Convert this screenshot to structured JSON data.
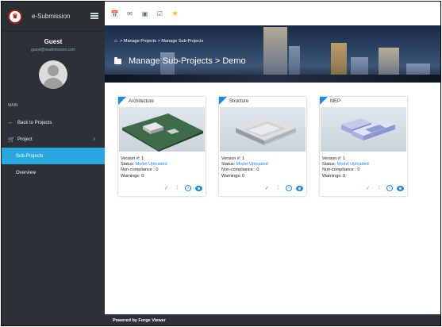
{
  "brand": {
    "name": "e-Submission",
    "logo_icon": "crest-logo"
  },
  "user": {
    "name": "Guest",
    "email": "guest@esubmission.com"
  },
  "sidebar": {
    "section_label": "MAIN",
    "items": [
      {
        "label": "Back to Projects",
        "icon": "arrow-left-icon"
      },
      {
        "label": "Project",
        "icon": "cart-icon"
      },
      {
        "label": "Sub-Projects",
        "active": true
      },
      {
        "label": "Overview"
      }
    ],
    "active_color": "#29a8e0"
  },
  "topbar": {
    "icons": [
      "calendar-icon",
      "mail-icon",
      "chat-icon",
      "checkbox-icon",
      "star-icon"
    ]
  },
  "breadcrumb": {
    "text": "> Manage Projects > Manage Sub-Projects"
  },
  "page_title": "Manage Sub-Projects > Demo",
  "cards": [
    {
      "title": "Architecture",
      "version_label": "Version #:",
      "version": "1",
      "status_label": "Status:",
      "status": "Model Uploaded",
      "noncompliance": "Non-compliance : 0",
      "warnings": "Warnings: 0"
    },
    {
      "title": "Structure",
      "version_label": "Version #:",
      "version": "1",
      "status_label": "Status:",
      "status": "Model Uploaded",
      "noncompliance": "Non-compliance : 0",
      "warnings": "Warnings: 0"
    },
    {
      "title": "MEP",
      "version_label": "Version #:",
      "version": "1",
      "status_label": "Status:",
      "status": "Model Uploaded",
      "noncompliance": "Non-compliance : 0",
      "warnings": "Warnings: 0"
    }
  ],
  "footer": {
    "text": "Powered by Forge Viewer"
  }
}
